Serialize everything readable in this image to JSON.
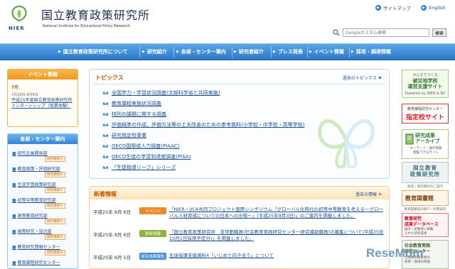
{
  "header": {
    "logo_text": "NIER",
    "title": "国立教育政策研究所",
    "subtitle": "National Institute for Educational Policy Research",
    "links": {
      "sitemap": "サイトマップ",
      "english": "English"
    },
    "search": {
      "placeholder": "Googleカスタム検索",
      "button_label": "検索"
    }
  },
  "colors": {
    "nav": "#2c78c7",
    "accent_orange": "#ee9a1f",
    "link": "#1d4f91",
    "topics_title": "#c55a00"
  },
  "nav": {
    "items": [
      {
        "label": "国立教育政策研究所について"
      },
      {
        "label": "研究紹介"
      },
      {
        "label": "各部・センター案内"
      },
      {
        "label": "研究者紹介"
      },
      {
        "label": "プレス発表"
      },
      {
        "label": "イベント情報"
      },
      {
        "label": "採用・調達情報"
      }
    ]
  },
  "event": {
    "header": "イベント情報",
    "month": "7月",
    "dates": "7月29日-8月9日",
    "title": "平成25年度国立教育政策研究所インターンシップ（就業体験）"
  },
  "centers": {
    "header": "各部・センター案内",
    "badge": "研究者紹介",
    "items": [
      {
        "label": "研究企画開発部"
      },
      {
        "label": "教育政策・評価研究部"
      },
      {
        "label": "生涯学習政策研究部"
      },
      {
        "label": "初等中等教育研究部"
      },
      {
        "label": "高等教育研究部"
      },
      {
        "label": "国際研究・協力部"
      },
      {
        "label": "教育研究情報センター"
      },
      {
        "label": "教育課程研究センター"
      }
    ]
  },
  "topics": {
    "title": "トピックス",
    "past_link": "過去のトピックス",
    "items": [
      {
        "label": "全国学力・学習状況調査(文部科学省と共同実施)"
      },
      {
        "label": "教育課程実施状況調査"
      },
      {
        "label": "特別の課題に関する調査"
      },
      {
        "label": "評価規準の作成，評価方法等の工夫改善のための参考資料(小学校・中学校・高等学校)"
      },
      {
        "label": "研究指定校事業"
      },
      {
        "label": "OECD国際成人力調査(PIAAC)"
      },
      {
        "label": "OECD生徒の学習到達度調査(PISA)"
      },
      {
        "label": "「生徒指導リーフ」シリーズ"
      }
    ]
  },
  "news": {
    "title": "新着情報",
    "past_link": "過去の情報",
    "items": [
      {
        "date": "平成25年 8月 6日",
        "tag": "イベント",
        "tag_color": "#e98a2b",
        "text": "「NIER・JICA共同プロジェクト国際シンポジウム『グローバル化時代の初等中等教育を考える～グローバル人材育成についての日本への示唆～』(平成25年9月3日)」のご案内を掲載しました。"
      },
      {
        "date": "平成25年 8月 6日",
        "tag": "更新情報",
        "tag_color": "#8bb33d",
        "text": "「国立教育政策研究所　非常勤職員(社会教育実践研究センター研究補助職員)の募集について(平成25年10月1日採用予定分)」を掲載しました。"
      },
      {
        "date": "平成25年 8月 5日",
        "tag": "研究成果報告",
        "tag_color": "#4a8fd3",
        "text": "生徒指導支援資料4「いじめと向き合う」について"
      }
    ]
  },
  "banners": {
    "b1": {
      "l1": "みんなでつくる",
      "l2": "被災地学校\n運営支援サイト",
      "l3": "Powered by NIER & NII"
    },
    "b2": {
      "l1": "教育課程研究センター",
      "l2": "指定校サイト"
    },
    "b3": {
      "l1": "研究成果\nアーカイブ",
      "l2": "キーワード・発行目録\n閲覧できるサイト"
    },
    "b4": {
      "l1": "国立教育\n政策研究所"
    },
    "b4_sub": "総合・研究資料のご案内",
    "b5": {
      "l1": "教育図書館"
    },
    "b5_sub": "教育図書館の紹介・利用案内",
    "b6": {
      "l1": "教育研究\n成果データベース",
      "l2": "論文・紀要等に掲載\nされた研究成果"
    },
    "b7": {
      "l1": "社会教育実践\n研究センター",
      "l2": "社会教育関係者の\n研修・地域の情報"
    }
  },
  "watermark": "ReseMom"
}
